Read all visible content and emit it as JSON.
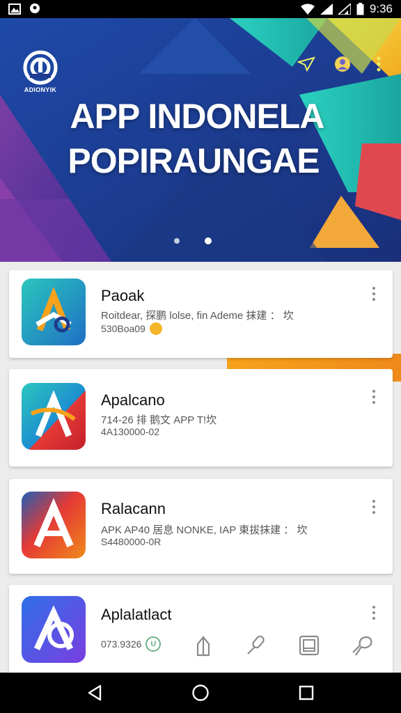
{
  "status_bar": {
    "time": "9:36",
    "icons": [
      "gallery-icon",
      "location-icon",
      "wifi-icon",
      "signal-icon",
      "signal-icon",
      "battery-icon"
    ]
  },
  "banner": {
    "logo_text": "ADIONYIK",
    "title_line1": "APP INDONELA",
    "title_line2": "POPIRAUNGAE",
    "actions": [
      "send-icon",
      "profile-icon",
      "more-icon"
    ],
    "carousel_pages": 2,
    "carousel_active": 1
  },
  "apps": [
    {
      "name": "Paoak",
      "description": "Roitdear, 探鹏 lolse, fin Ademe 抹建 ： 坎",
      "meta": "530Boa09",
      "icon": "app-icon-teal"
    },
    {
      "name": "Apalcano",
      "description": "714-26 排 鹅文 APP T!坎",
      "meta": "4A130000-02",
      "icon": "app-icon-red-teal"
    },
    {
      "name": "Ralacann",
      "description": "APK AP40 居息 NONKE, IAP 東拔抹建 ： 坎",
      "meta": "S4480000-0R",
      "icon": "app-icon-red-orange"
    },
    {
      "name": "Aplalatlact",
      "meta": "073.9326",
      "icon": "app-icon-blue-purple",
      "actions": [
        "share-icon",
        "mic-icon",
        "gallery-icon",
        "settings-icon"
      ]
    }
  ],
  "nav_bar": {
    "buttons": [
      "back-icon",
      "home-icon",
      "recents-icon"
    ]
  },
  "colors": {
    "banner_base": "#1f3b8f",
    "accent_teal": "#1fb7b0",
    "accent_orange": "#f7a21c",
    "accent_red": "#e53935"
  }
}
